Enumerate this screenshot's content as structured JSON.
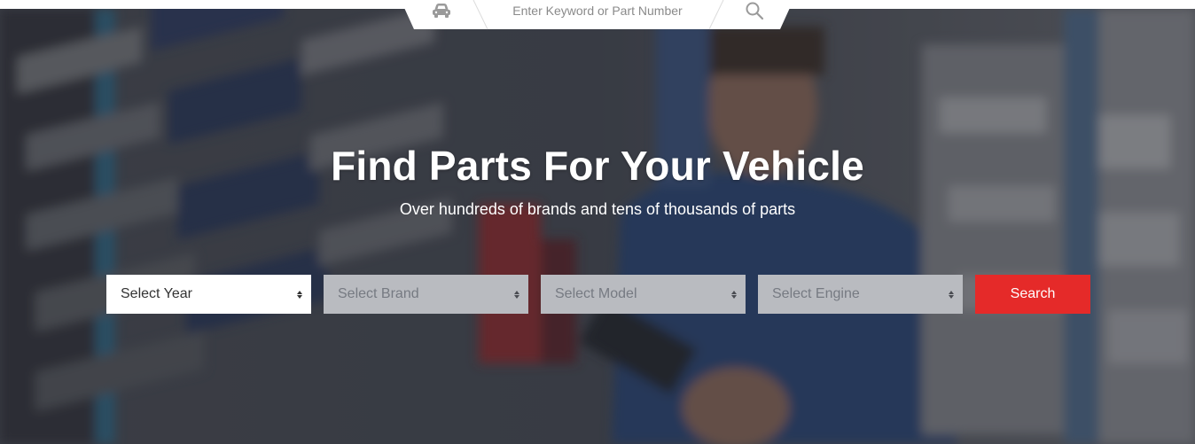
{
  "keyword_search": {
    "placeholder": "Enter Keyword or Part Number",
    "car_icon": "car-icon",
    "search_icon": "magnifier-icon"
  },
  "hero": {
    "title": "Find Parts For Your Vehicle",
    "subtitle": "Over hundreds of brands and tens of thousands of parts"
  },
  "selectors": {
    "year": "Select Year",
    "brand": "Select Brand",
    "model": "Select Model",
    "engine": "Select Engine"
  },
  "search_button": "Search",
  "colors": {
    "accent": "#e52a29",
    "overlay": "#2a2c32",
    "disabled_select": "#b9bbc0"
  }
}
